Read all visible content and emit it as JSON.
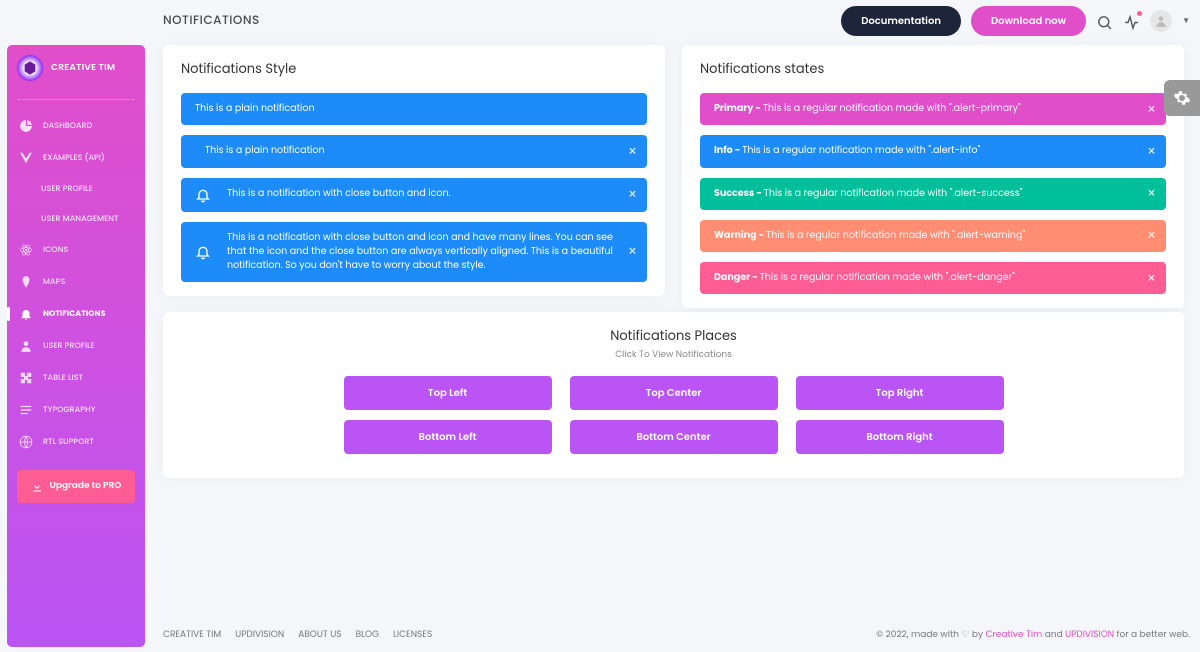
{
  "brand": "CREATIVE TIM",
  "nav": {
    "dashboard": "DASHBOARD",
    "examples": "EXAMPLES (API)",
    "userProfile1": "USER PROFILE",
    "userMgmt": "USER MANAGEMENT",
    "menuIcons": "ICONS",
    "maps": "MAPS",
    "notifications": "NOTIFICATIONS",
    "userProfile2": "USER PROFILE",
    "tableList": "TABLE LIST",
    "typography": "TYPOGRAPHY",
    "rtl": "RTL SUPPORT",
    "upgrade": "Upgrade to PRO"
  },
  "header": {
    "title": "NOTIFICATIONS",
    "docs": "Documentation",
    "download": "Download now"
  },
  "style": {
    "title": "Notifications Style",
    "a1": "This is a plain notification",
    "a2": "This is a plain notification",
    "a3": "This is a notification with close button and icon.",
    "a4": "This is a notification with close button and icon and have many lines. You can see that the icon and the close button are always vertically aligned. This is a beautiful notification. So you don't have to worry about the style."
  },
  "states": {
    "title": "Notifications states",
    "primaryLabel": "Primary - ",
    "primaryMsg": "This is a regular notification made with \".alert-primary\"",
    "infoLabel": "Info - ",
    "infoMsg": "This is a regular notification made with \".alert-info\"",
    "successLabel": "Success - ",
    "successMsg": "This is a regular notification made with \".alert-success\"",
    "warningLabel": "Warning - ",
    "warningMsg": "This is a regular notification made with \".alert-warning\"",
    "dangerLabel": "Danger - ",
    "dangerMsg": "This is a regular notification made with \".alert-danger\""
  },
  "places": {
    "title": "Notifications Places",
    "sub": "Click To View Notifications",
    "tl": "Top Left",
    "tc": "Top Center",
    "tr": "Top Right",
    "bl": "Bottom Left",
    "bc": "Bottom Center",
    "br": "Bottom Right"
  },
  "footer": {
    "l1": "CREATIVE TIM",
    "l2": "UPDIVISION",
    "l3": "ABOUT US",
    "l4": "BLOG",
    "l5": "LICENSES",
    "copy1": "© 2022, made with ♡ by ",
    "ct": "Creative Tim",
    "and": " and ",
    "ud": "UPDIVISION",
    "copy2": " for a better web."
  }
}
